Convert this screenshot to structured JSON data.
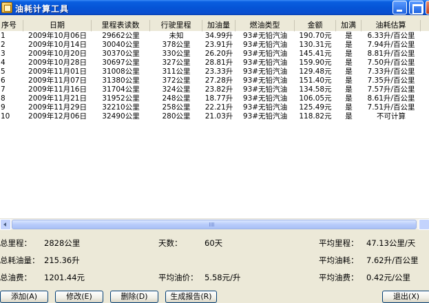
{
  "window": {
    "title": "油耗计算工具"
  },
  "grid": {
    "headers": [
      "序号",
      "日期",
      "里程表读数",
      "行驶里程",
      "加油量",
      "燃油类型",
      "金额",
      "加满",
      "油耗估算",
      ""
    ],
    "rows": [
      [
        "1",
        "2009年10月06日",
        "29662公里",
        "未知",
        "34.99升",
        "93#无铅汽油",
        "190.70元",
        "是",
        "6.33升/百公里"
      ],
      [
        "2",
        "2009年10月14日",
        "30040公里",
        "378公里",
        "23.91升",
        "93#无铅汽油",
        "130.31元",
        "是",
        "7.94升/百公里"
      ],
      [
        "3",
        "2009年10月20日",
        "30370公里",
        "330公里",
        "26.20升",
        "93#无铅汽油",
        "145.41元",
        "是",
        "8.81升/百公里"
      ],
      [
        "4",
        "2009年10月28日",
        "30697公里",
        "327公里",
        "28.81升",
        "93#无铅汽油",
        "159.90元",
        "是",
        "7.50升/百公里"
      ],
      [
        "5",
        "2009年11月01日",
        "31008公里",
        "311公里",
        "23.33升",
        "93#无铅汽油",
        "129.48元",
        "是",
        "7.33升/百公里"
      ],
      [
        "6",
        "2009年11月07日",
        "31380公里",
        "372公里",
        "27.28升",
        "93#无铅汽油",
        "151.40元",
        "是",
        "7.35升/百公里"
      ],
      [
        "7",
        "2009年11月16日",
        "31704公里",
        "324公里",
        "23.82升",
        "93#无铅汽油",
        "134.58元",
        "是",
        "7.57升/百公里"
      ],
      [
        "8",
        "2009年11月21日",
        "31952公里",
        "248公里",
        "18.77升",
        "93#无铅汽油",
        "106.05元",
        "是",
        "8.61升/百公里"
      ],
      [
        "9",
        "2009年11月29日",
        "32210公里",
        "258公里",
        "22.21升",
        "93#无铅汽油",
        "125.49元",
        "是",
        "7.51升/百公里"
      ],
      [
        "10",
        "2009年12月06日",
        "32490公里",
        "280公里",
        "21.03升",
        "93#无铅汽油",
        "118.82元",
        "是",
        "不可计算"
      ]
    ]
  },
  "summary": {
    "total_distance_label": "总里程：",
    "total_distance": "2828公里",
    "days_label": "天数：",
    "days": "60天",
    "avg_distance_label": "平均里程：",
    "avg_distance": "47.13公里/天",
    "total_fuel_label": "总耗油量：",
    "total_fuel": "215.36升",
    "avg_consumption_label": "平均油耗：",
    "avg_consumption": "7.62升/百公里",
    "total_cost_label": "总油费：",
    "total_cost": "1201.44元",
    "avg_price_label": "平均油价：",
    "avg_price": "5.58元/升",
    "avg_cost_label": "平均油费：",
    "avg_cost": "0.42元/公里"
  },
  "buttons": {
    "add": "添加(A)",
    "edit": "修改(E)",
    "delete": "删除(D)",
    "report": "生成报告(R)",
    "exit": "退出(X)"
  },
  "icons": {
    "app": "fuel-calculator-app-icon",
    "minimize": "minimize-icon",
    "maximize": "maximize-icon",
    "close": "close-icon",
    "scroll_left": "arrow-left-icon",
    "scroll_right": "arrow-right-icon"
  }
}
